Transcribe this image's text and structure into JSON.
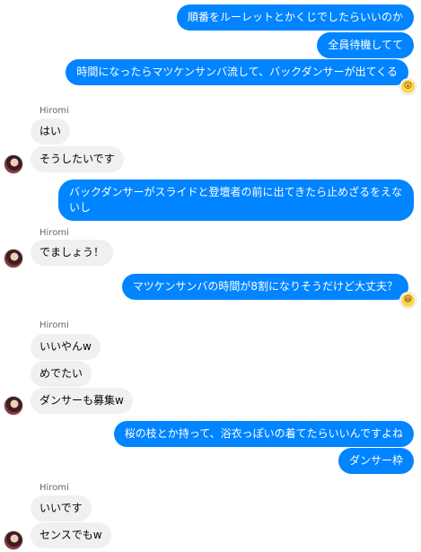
{
  "messages_right": [
    {
      "text": "順番をルーレットとかくじでしたらいいのか"
    },
    {
      "text": "全員待機してて"
    },
    {
      "text": "時間になったらマツケンサンバ流して、バックダンサーが出てくる"
    },
    {
      "text": "バックダンサーがスライドと登壇者の前に出てきたら止めざるをえないし"
    },
    {
      "text": "マツケンサンバの時間が8割になりそうだけど大丈夫？"
    },
    {
      "text": "桜の枝とか持って、浴衣っぽいの着てたらいいんですよね"
    },
    {
      "text": "ダンサー枠"
    }
  ],
  "groups_left": [
    {
      "sender": "Hiromi",
      "messages": [
        "はい",
        "そうしたいです"
      ]
    },
    {
      "sender": "Hiromi",
      "messages": [
        "でましょう！"
      ]
    },
    {
      "sender": "Hiromi",
      "messages": [
        "いいやんw",
        "めでたい",
        "ダンサーも募集w"
      ]
    },
    {
      "sender": "Hiromi",
      "messages": [
        "いいです",
        "センスでもw"
      ]
    }
  ],
  "reactions": [
    {
      "icon": "wow-emoji-icon",
      "glyph": "😮"
    },
    {
      "icon": "laugh-emoji-icon",
      "glyph": "😆"
    }
  ]
}
